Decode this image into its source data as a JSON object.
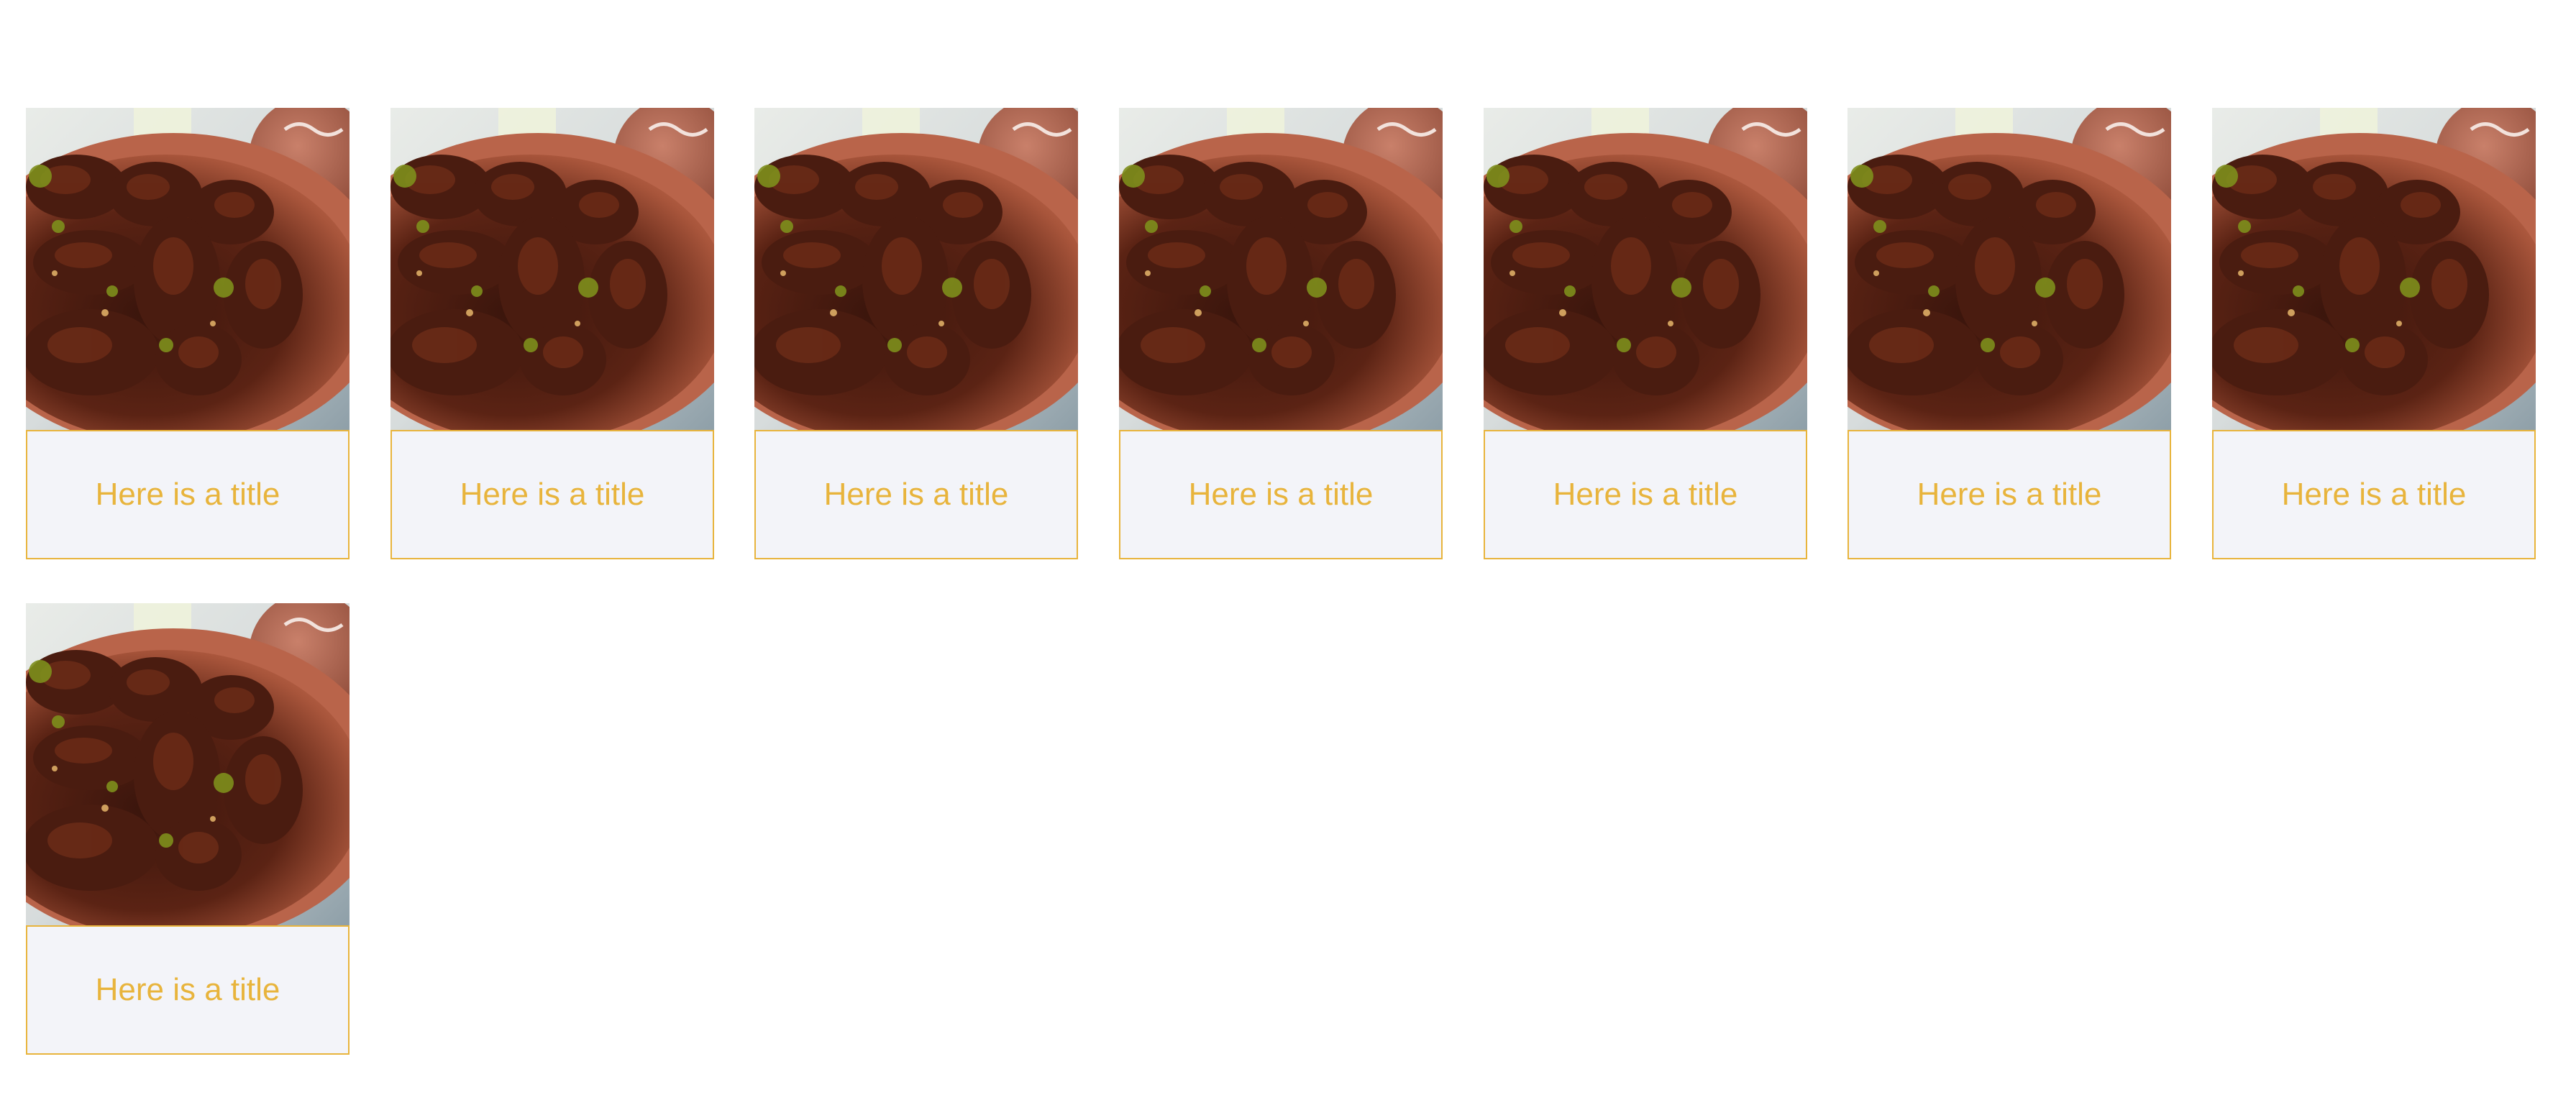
{
  "colors": {
    "accent": "#e8b43c",
    "card_footer_bg": "#f3f4f9",
    "page_bg": "#ffffff"
  },
  "cards": [
    {
      "title": "Here is a title",
      "image": "food-photo"
    },
    {
      "title": "Here is a title",
      "image": "food-photo"
    },
    {
      "title": "Here is a title",
      "image": "food-photo"
    },
    {
      "title": "Here is a title",
      "image": "food-photo"
    },
    {
      "title": "Here is a title",
      "image": "food-photo"
    },
    {
      "title": "Here is a title",
      "image": "food-photo"
    },
    {
      "title": "Here is a title",
      "image": "food-photo"
    },
    {
      "title": "Here is a title",
      "image": "food-photo"
    }
  ]
}
